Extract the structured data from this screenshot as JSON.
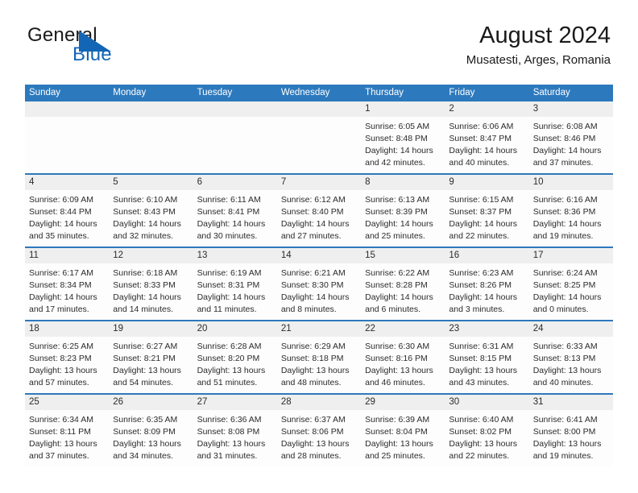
{
  "brand": {
    "line1": "General",
    "line2": "Blue",
    "accent_color": "#1266b5"
  },
  "header": {
    "title": "August 2024",
    "subtitle": "Musatesti, Arges, Romania"
  },
  "calendar": {
    "header_bg": "#2d79bd",
    "number_band_bg": "#efefef",
    "weekdays": [
      "Sunday",
      "Monday",
      "Tuesday",
      "Wednesday",
      "Thursday",
      "Friday",
      "Saturday"
    ],
    "weeks": [
      [
        {
          "day": "",
          "lines": []
        },
        {
          "day": "",
          "lines": []
        },
        {
          "day": "",
          "lines": []
        },
        {
          "day": "",
          "lines": []
        },
        {
          "day": "1",
          "lines": [
            "Sunrise: 6:05 AM",
            "Sunset: 8:48 PM",
            "Daylight: 14 hours",
            "and 42 minutes."
          ]
        },
        {
          "day": "2",
          "lines": [
            "Sunrise: 6:06 AM",
            "Sunset: 8:47 PM",
            "Daylight: 14 hours",
            "and 40 minutes."
          ]
        },
        {
          "day": "3",
          "lines": [
            "Sunrise: 6:08 AM",
            "Sunset: 8:46 PM",
            "Daylight: 14 hours",
            "and 37 minutes."
          ]
        }
      ],
      [
        {
          "day": "4",
          "lines": [
            "Sunrise: 6:09 AM",
            "Sunset: 8:44 PM",
            "Daylight: 14 hours",
            "and 35 minutes."
          ]
        },
        {
          "day": "5",
          "lines": [
            "Sunrise: 6:10 AM",
            "Sunset: 8:43 PM",
            "Daylight: 14 hours",
            "and 32 minutes."
          ]
        },
        {
          "day": "6",
          "lines": [
            "Sunrise: 6:11 AM",
            "Sunset: 8:41 PM",
            "Daylight: 14 hours",
            "and 30 minutes."
          ]
        },
        {
          "day": "7",
          "lines": [
            "Sunrise: 6:12 AM",
            "Sunset: 8:40 PM",
            "Daylight: 14 hours",
            "and 27 minutes."
          ]
        },
        {
          "day": "8",
          "lines": [
            "Sunrise: 6:13 AM",
            "Sunset: 8:39 PM",
            "Daylight: 14 hours",
            "and 25 minutes."
          ]
        },
        {
          "day": "9",
          "lines": [
            "Sunrise: 6:15 AM",
            "Sunset: 8:37 PM",
            "Daylight: 14 hours",
            "and 22 minutes."
          ]
        },
        {
          "day": "10",
          "lines": [
            "Sunrise: 6:16 AM",
            "Sunset: 8:36 PM",
            "Daylight: 14 hours",
            "and 19 minutes."
          ]
        }
      ],
      [
        {
          "day": "11",
          "lines": [
            "Sunrise: 6:17 AM",
            "Sunset: 8:34 PM",
            "Daylight: 14 hours",
            "and 17 minutes."
          ]
        },
        {
          "day": "12",
          "lines": [
            "Sunrise: 6:18 AM",
            "Sunset: 8:33 PM",
            "Daylight: 14 hours",
            "and 14 minutes."
          ]
        },
        {
          "day": "13",
          "lines": [
            "Sunrise: 6:19 AM",
            "Sunset: 8:31 PM",
            "Daylight: 14 hours",
            "and 11 minutes."
          ]
        },
        {
          "day": "14",
          "lines": [
            "Sunrise: 6:21 AM",
            "Sunset: 8:30 PM",
            "Daylight: 14 hours",
            "and 8 minutes."
          ]
        },
        {
          "day": "15",
          "lines": [
            "Sunrise: 6:22 AM",
            "Sunset: 8:28 PM",
            "Daylight: 14 hours",
            "and 6 minutes."
          ]
        },
        {
          "day": "16",
          "lines": [
            "Sunrise: 6:23 AM",
            "Sunset: 8:26 PM",
            "Daylight: 14 hours",
            "and 3 minutes."
          ]
        },
        {
          "day": "17",
          "lines": [
            "Sunrise: 6:24 AM",
            "Sunset: 8:25 PM",
            "Daylight: 14 hours",
            "and 0 minutes."
          ]
        }
      ],
      [
        {
          "day": "18",
          "lines": [
            "Sunrise: 6:25 AM",
            "Sunset: 8:23 PM",
            "Daylight: 13 hours",
            "and 57 minutes."
          ]
        },
        {
          "day": "19",
          "lines": [
            "Sunrise: 6:27 AM",
            "Sunset: 8:21 PM",
            "Daylight: 13 hours",
            "and 54 minutes."
          ]
        },
        {
          "day": "20",
          "lines": [
            "Sunrise: 6:28 AM",
            "Sunset: 8:20 PM",
            "Daylight: 13 hours",
            "and 51 minutes."
          ]
        },
        {
          "day": "21",
          "lines": [
            "Sunrise: 6:29 AM",
            "Sunset: 8:18 PM",
            "Daylight: 13 hours",
            "and 48 minutes."
          ]
        },
        {
          "day": "22",
          "lines": [
            "Sunrise: 6:30 AM",
            "Sunset: 8:16 PM",
            "Daylight: 13 hours",
            "and 46 minutes."
          ]
        },
        {
          "day": "23",
          "lines": [
            "Sunrise: 6:31 AM",
            "Sunset: 8:15 PM",
            "Daylight: 13 hours",
            "and 43 minutes."
          ]
        },
        {
          "day": "24",
          "lines": [
            "Sunrise: 6:33 AM",
            "Sunset: 8:13 PM",
            "Daylight: 13 hours",
            "and 40 minutes."
          ]
        }
      ],
      [
        {
          "day": "25",
          "lines": [
            "Sunrise: 6:34 AM",
            "Sunset: 8:11 PM",
            "Daylight: 13 hours",
            "and 37 minutes."
          ]
        },
        {
          "day": "26",
          "lines": [
            "Sunrise: 6:35 AM",
            "Sunset: 8:09 PM",
            "Daylight: 13 hours",
            "and 34 minutes."
          ]
        },
        {
          "day": "27",
          "lines": [
            "Sunrise: 6:36 AM",
            "Sunset: 8:08 PM",
            "Daylight: 13 hours",
            "and 31 minutes."
          ]
        },
        {
          "day": "28",
          "lines": [
            "Sunrise: 6:37 AM",
            "Sunset: 8:06 PM",
            "Daylight: 13 hours",
            "and 28 minutes."
          ]
        },
        {
          "day": "29",
          "lines": [
            "Sunrise: 6:39 AM",
            "Sunset: 8:04 PM",
            "Daylight: 13 hours",
            "and 25 minutes."
          ]
        },
        {
          "day": "30",
          "lines": [
            "Sunrise: 6:40 AM",
            "Sunset: 8:02 PM",
            "Daylight: 13 hours",
            "and 22 minutes."
          ]
        },
        {
          "day": "31",
          "lines": [
            "Sunrise: 6:41 AM",
            "Sunset: 8:00 PM",
            "Daylight: 13 hours",
            "and 19 minutes."
          ]
        }
      ]
    ]
  }
}
